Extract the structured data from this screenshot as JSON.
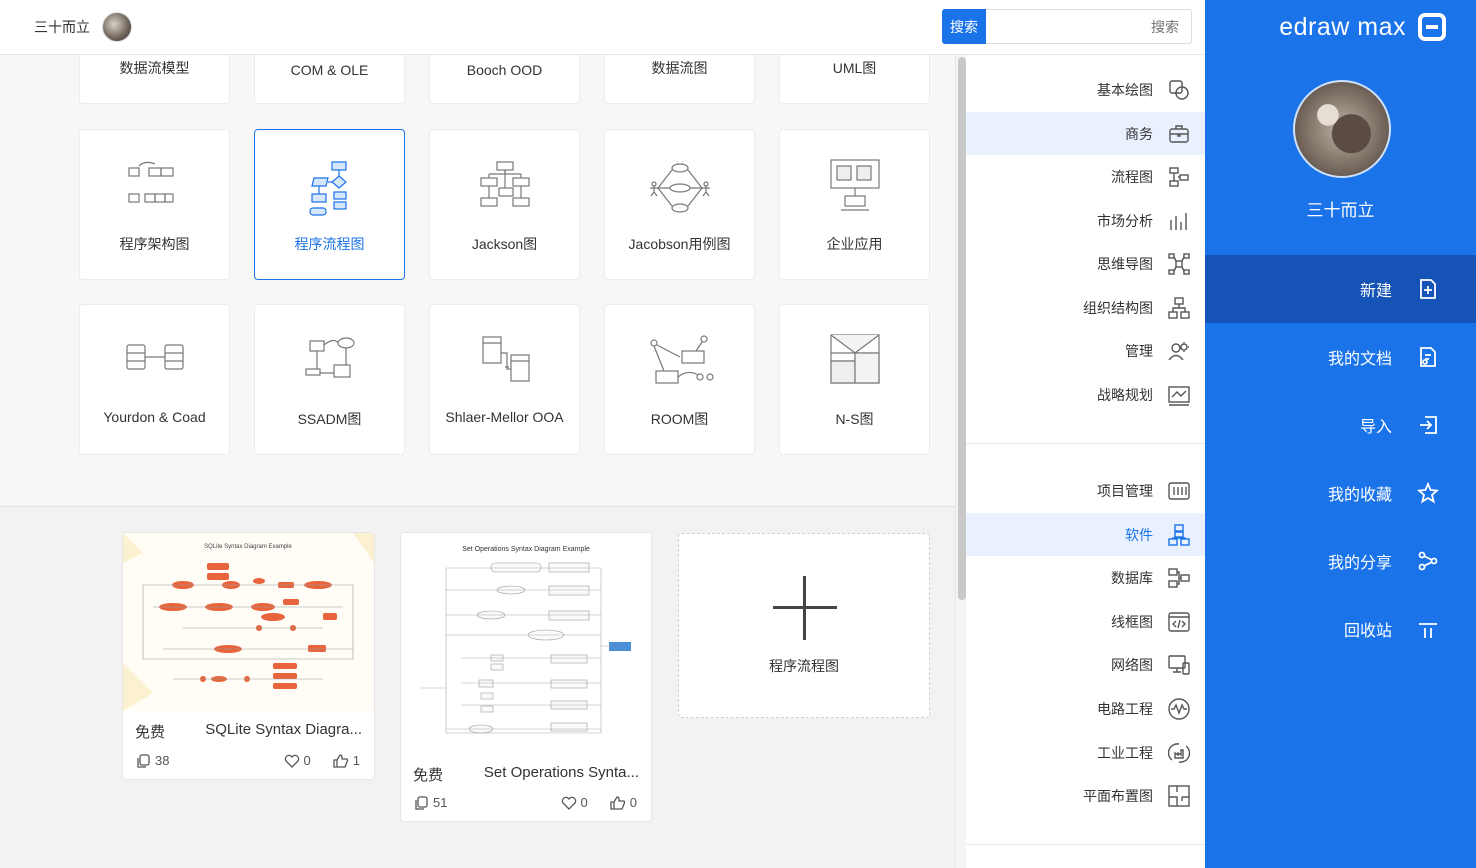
{
  "topbar": {
    "user_name": "三十而立",
    "search_button": "搜索",
    "search_placeholder": "搜索"
  },
  "sidebar": {
    "logo": "edraw max",
    "user_name": "三十而立",
    "items": [
      {
        "label": "新建",
        "icon": "new-file-icon",
        "active": true
      },
      {
        "label": "我的文档",
        "icon": "documents-icon",
        "active": false
      },
      {
        "label": "导入",
        "icon": "import-icon",
        "active": false
      },
      {
        "label": "我的收藏",
        "icon": "star-icon",
        "active": false
      },
      {
        "label": "我的分享",
        "icon": "share-icon",
        "active": false
      },
      {
        "label": "回收站",
        "icon": "trash-icon",
        "active": false
      }
    ]
  },
  "categories": {
    "group1": [
      {
        "label": "基本绘图",
        "icon": "basic-shapes-icon"
      },
      {
        "label": "商务",
        "icon": "briefcase-icon",
        "active": true
      },
      {
        "label": "流程图",
        "icon": "flowchart-icon"
      },
      {
        "label": "市场分析",
        "icon": "bar-chart-icon"
      },
      {
        "label": "思维导图",
        "icon": "mindmap-icon"
      },
      {
        "label": "组织结构图",
        "icon": "org-chart-icon"
      },
      {
        "label": "管理",
        "icon": "gear-people-icon"
      },
      {
        "label": "战略规划",
        "icon": "strategy-icon"
      }
    ],
    "group2": [
      {
        "label": "项目管理",
        "icon": "project-icon"
      },
      {
        "label": "软件",
        "icon": "software-icon",
        "active": true
      },
      {
        "label": "数据库",
        "icon": "database-icon"
      },
      {
        "label": "线框图",
        "icon": "wireframe-icon"
      },
      {
        "label": "网络图",
        "icon": "network-icon"
      },
      {
        "label": "电路工程",
        "icon": "circuit-icon"
      },
      {
        "label": "工业工程",
        "icon": "industry-icon"
      },
      {
        "label": "平面布置图",
        "icon": "floorplan-icon"
      }
    ]
  },
  "templates": {
    "row0": [
      "数据流模型",
      "COM & OLE",
      "Booch OOD",
      "数据流图",
      "UML图"
    ],
    "row1": [
      "程序架构图",
      "程序流程图",
      "Jackson图",
      "Jacobson用例图",
      "企业应用"
    ],
    "row2": [
      "Yourdon & Coad",
      "SSADM图",
      "Shlaer-Mellor OOA",
      "ROOM图",
      "N-S图"
    ]
  },
  "examples": [
    {
      "title": "SQLite Syntax Diagra...",
      "price": "免费",
      "likes": "1",
      "hearts": "0",
      "copies": "38",
      "thumb_title": "SQLite Syntax Diagram Example"
    },
    {
      "title": "Set Operations Synta...",
      "price": "免费",
      "likes": "0",
      "hearts": "0",
      "copies": "51",
      "thumb_title": "Set Operations Syntax Diagram Example"
    }
  ],
  "new_card_label": "程序流程图",
  "colors": {
    "accent": "#1a73e8",
    "accent_dark": "#1553b6",
    "orange": "#e8643c"
  }
}
